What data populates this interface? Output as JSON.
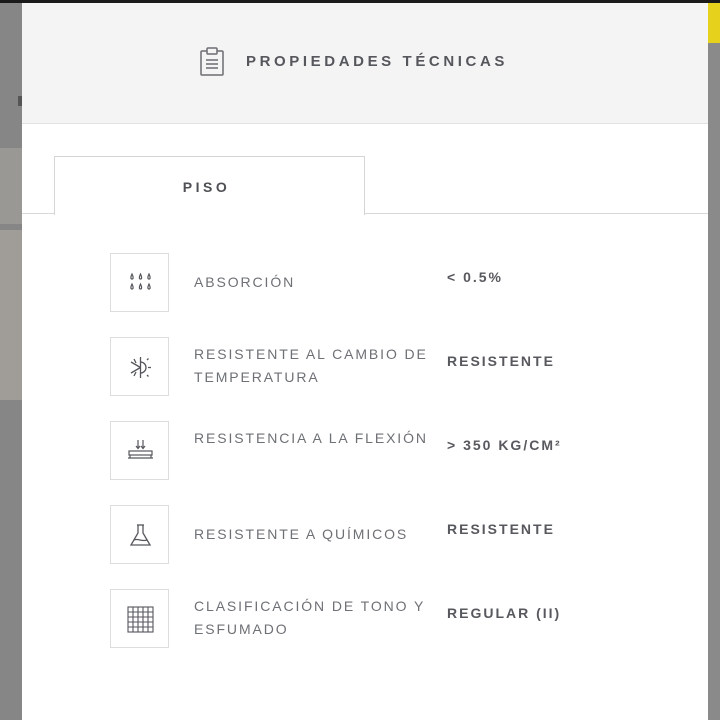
{
  "modal": {
    "title": "PROPIEDADES TÉCNICAS",
    "header_icon": "clipboard-icon",
    "tabs": [
      {
        "label": "PISO",
        "active": true
      }
    ]
  },
  "properties": [
    {
      "icon": "water-drops-icon",
      "label": "ABSORCIÓN",
      "value": "< 0.5%"
    },
    {
      "icon": "snowflake-sun-icon",
      "label": "RESISTENTE AL CAMBIO DE TEMPERATURA",
      "value": "RESISTENTE"
    },
    {
      "icon": "flexion-load-icon",
      "label": "RESISTENCIA A LA FLEXIÓN",
      "value": "> 350 KG/CM²"
    },
    {
      "icon": "flask-icon",
      "label": "RESISTENTE A QUÍMICOS",
      "value": "RESISTENTE"
    },
    {
      "icon": "grid-icon",
      "label": "CLASIFICACIÓN DE TONO Y ESFUMADO",
      "value": "REGULAR (II)"
    }
  ],
  "colors": {
    "header_bg": "#f4f4f4",
    "text_primary": "#55575c",
    "overlay_bg": "#8c8c8c",
    "accent_yellow": "#e6d21c",
    "accent_red": "#c2374a"
  }
}
